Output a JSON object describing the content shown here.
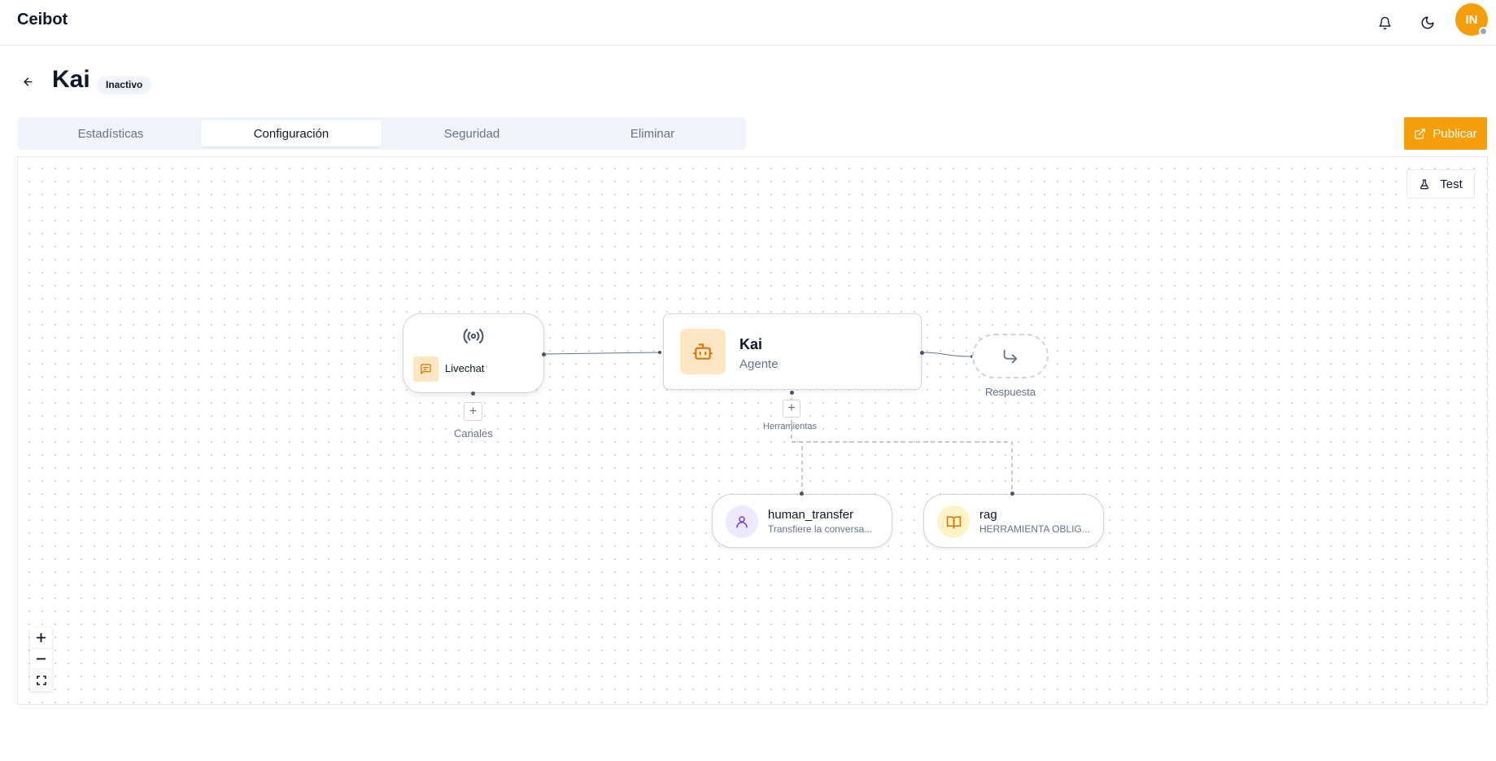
{
  "app": {
    "brand": "Ceibot",
    "avatar_initials": "IN"
  },
  "header": {
    "title": "Kai",
    "status": "Inactivo"
  },
  "tabs": [
    {
      "label": "Estadísticas",
      "active": false
    },
    {
      "label": "Configuración",
      "active": true
    },
    {
      "label": "Seguridad",
      "active": false
    },
    {
      "label": "Eliminar",
      "active": false
    }
  ],
  "actions": {
    "publish_label": "Publicar",
    "test_label": "Test"
  },
  "flow": {
    "channel": {
      "name": "Livechat",
      "caption": "Canales"
    },
    "agent": {
      "name": "Kai",
      "role": "Agente",
      "tools_caption": "Herramientas"
    },
    "response": {
      "caption": "Respuesta"
    },
    "tools": [
      {
        "name": "human_transfer",
        "description": "Transfiere la conversa...",
        "icon": "user-icon"
      },
      {
        "name": "rag",
        "description": "HERRAMIENTA OBLIG...",
        "icon": "book-open-icon"
      }
    ]
  },
  "colors": {
    "accent": "#f59e0b",
    "accent_soft": "#fde6c4",
    "tool_user": "#ede9fe",
    "tool_book": "#fef3c7"
  }
}
